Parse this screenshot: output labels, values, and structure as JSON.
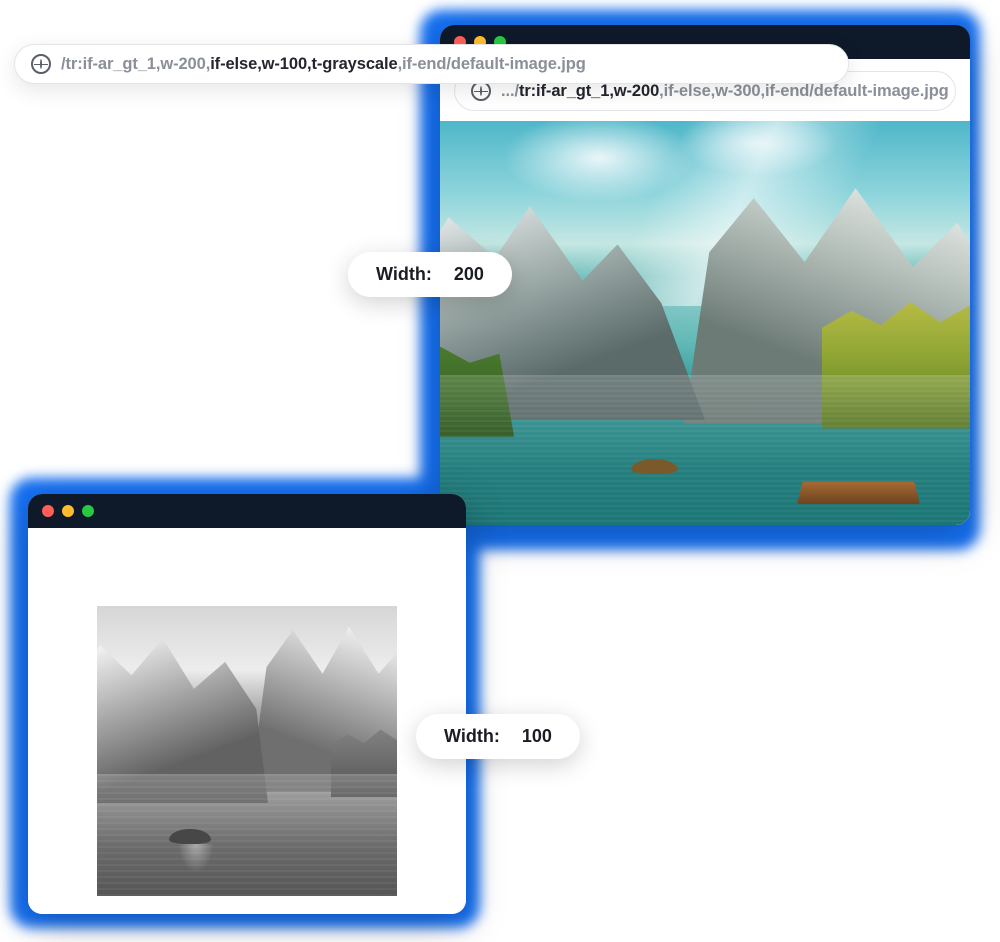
{
  "window1": {
    "url": {
      "prefix": ".../",
      "seg1": "tr:if-ar_gt_1,w-200",
      "seg2": ",if-else,w-300,if-end",
      "seg3": "/default-image.jpg"
    },
    "badge": {
      "label": "Width:",
      "value": "200"
    }
  },
  "window2": {
    "url": {
      "prefix": "/tr:if-ar_gt_1,w-200,",
      "seg1": "if-else,w-100,t-grayscale",
      "seg2": ",if-end",
      "seg3": "/default-image.jpg"
    },
    "badge": {
      "label": "Width:",
      "value": "100"
    }
  }
}
